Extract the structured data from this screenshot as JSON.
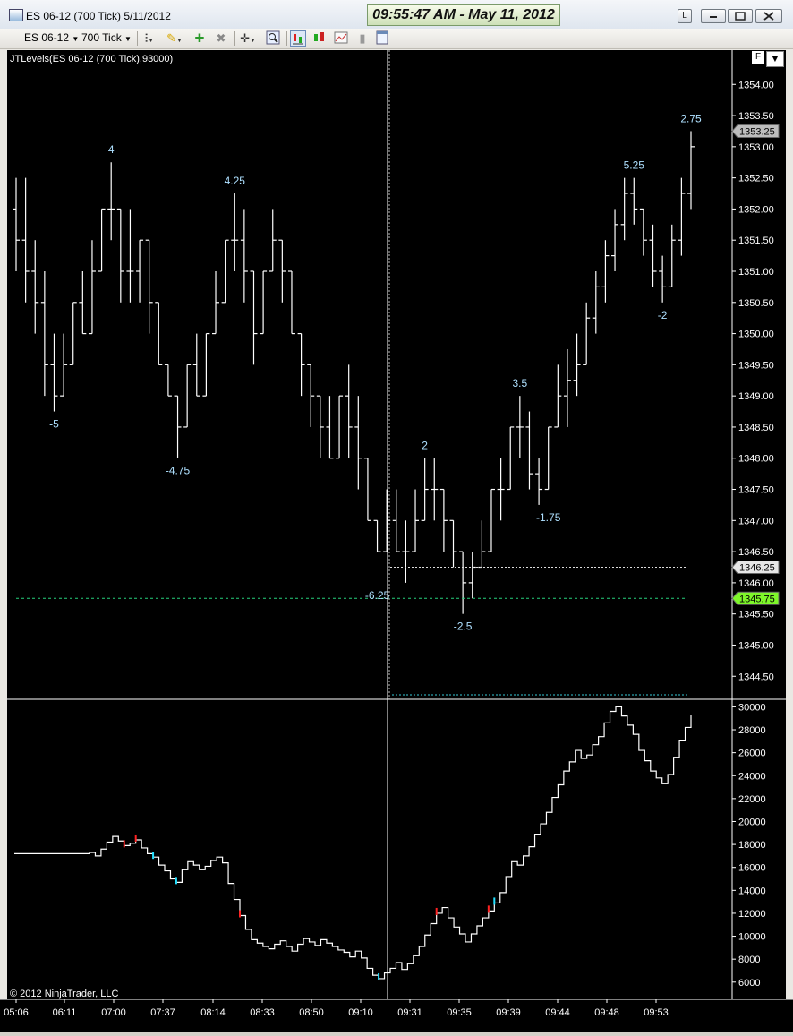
{
  "window": {
    "title": "ES 06-12 (700 Tick)  5/11/2012",
    "clock": "09:55:47 AM - May 11, 2012",
    "btn_l": "L"
  },
  "toolbar": {
    "instrument": "ES 06-12",
    "period": "700 Tick"
  },
  "indicator_label": "JTLevels(ES 06-12 (700 Tick),93000)",
  "f_button": "F",
  "copyright": "© 2012 NinjaTrader, LLC",
  "colors": {
    "background": "#000000",
    "bars": "#ffffff",
    "level_label": "#aee0ff",
    "green_line": "#26d07c",
    "cyan_line": "#36c9d6",
    "current_price": "#7ef72a",
    "marker_red": "#ff2222",
    "marker_cyan": "#22e0ff"
  },
  "chart_data": [
    {
      "type": "ohlc",
      "price_axis": {
        "ticks": [
          "1354.00",
          "1353.50",
          "1353.00",
          "1352.50",
          "1352.00",
          "1351.50",
          "1351.00",
          "1350.50",
          "1350.00",
          "1349.50",
          "1349.00",
          "1348.50",
          "1348.00",
          "1347.50",
          "1347.00",
          "1346.50",
          "1346.00",
          "1345.50",
          "1345.00",
          "1344.50"
        ],
        "range": [
          1344.13,
          1354.55
        ]
      },
      "price_labels": [
        {
          "text": "1353.25",
          "value": 1353.25,
          "style": "gray"
        },
        {
          "text": "1346.25",
          "value": 1346.25,
          "style": "light"
        },
        {
          "text": "1345.75",
          "value": 1345.75,
          "style": "green"
        }
      ],
      "levels": [
        {
          "text": "4",
          "value": 1352.75,
          "side": "high"
        },
        {
          "text": "-5",
          "value": 1348.75,
          "side": "low"
        },
        {
          "text": "4.25",
          "value": 1352.25,
          "side": "high"
        },
        {
          "text": "-4.75",
          "value": 1348.0,
          "side": "low"
        },
        {
          "text": "2",
          "value": 1348.0,
          "side": "high"
        },
        {
          "text": "-6.25",
          "value": 1346.0,
          "side": "low"
        },
        {
          "text": "-2.5",
          "value": 1345.5,
          "side": "low"
        },
        {
          "text": "3.5",
          "value": 1349.0,
          "side": "high"
        },
        {
          "text": "-1.75",
          "value": 1347.25,
          "side": "low"
        },
        {
          "text": "5.25",
          "value": 1352.5,
          "side": "high"
        },
        {
          "text": "-2",
          "value": 1350.5,
          "side": "low"
        },
        {
          "text": "2.75",
          "value": 1353.25,
          "side": "high"
        }
      ],
      "horizontal_lines": [
        {
          "value": 1346.25,
          "style": "dotted-white"
        },
        {
          "value": 1345.75,
          "style": "dashed-green"
        }
      ],
      "bars": [
        [
          1352.0,
          1352.5,
          1351.0,
          1351.5
        ],
        [
          1351.5,
          1352.5,
          1350.5,
          1351.0
        ],
        [
          1351.0,
          1351.5,
          1350.0,
          1350.5
        ],
        [
          1350.5,
          1351.0,
          1349.0,
          1349.5
        ],
        [
          1349.5,
          1350.0,
          1348.75,
          1349.0
        ],
        [
          1349.0,
          1350.0,
          1349.0,
          1349.5
        ],
        [
          1349.5,
          1350.5,
          1349.5,
          1350.5
        ],
        [
          1350.5,
          1351.0,
          1350.0,
          1350.0
        ],
        [
          1350.0,
          1351.5,
          1350.0,
          1351.0
        ],
        [
          1351.0,
          1352.0,
          1351.0,
          1352.0
        ],
        [
          1352.0,
          1352.75,
          1351.5,
          1352.0
        ],
        [
          1352.0,
          1352.0,
          1350.5,
          1351.0
        ],
        [
          1351.0,
          1352.0,
          1350.5,
          1351.0
        ],
        [
          1351.0,
          1351.5,
          1350.5,
          1351.5
        ],
        [
          1351.5,
          1351.5,
          1350.0,
          1350.5
        ],
        [
          1350.5,
          1350.5,
          1349.5,
          1349.5
        ],
        [
          1349.5,
          1349.5,
          1349.0,
          1349.0
        ],
        [
          1349.0,
          1349.0,
          1348.0,
          1348.5
        ],
        [
          1348.5,
          1349.5,
          1348.5,
          1349.5
        ],
        [
          1349.5,
          1350.0,
          1349.0,
          1349.0
        ],
        [
          1349.0,
          1350.0,
          1349.0,
          1350.0
        ],
        [
          1350.0,
          1351.0,
          1350.0,
          1350.5
        ],
        [
          1350.5,
          1351.5,
          1350.5,
          1351.5
        ],
        [
          1351.5,
          1352.25,
          1351.0,
          1351.5
        ],
        [
          1351.5,
          1352.0,
          1350.5,
          1351.0
        ],
        [
          1351.0,
          1351.0,
          1349.5,
          1350.0
        ],
        [
          1350.0,
          1351.0,
          1350.0,
          1351.0
        ],
        [
          1351.0,
          1352.0,
          1351.0,
          1351.5
        ],
        [
          1351.5,
          1351.5,
          1350.5,
          1351.0
        ],
        [
          1351.0,
          1351.0,
          1350.0,
          1350.0
        ],
        [
          1350.0,
          1350.0,
          1349.0,
          1349.5
        ],
        [
          1349.5,
          1349.5,
          1348.5,
          1349.0
        ],
        [
          1349.0,
          1349.0,
          1348.0,
          1348.5
        ],
        [
          1348.5,
          1349.0,
          1348.0,
          1348.0
        ],
        [
          1348.0,
          1349.0,
          1348.0,
          1349.0
        ],
        [
          1349.0,
          1349.5,
          1348.0,
          1348.5
        ],
        [
          1348.5,
          1349.0,
          1347.5,
          1348.0
        ],
        [
          1348.0,
          1348.0,
          1347.0,
          1347.0
        ],
        [
          1347.0,
          1347.0,
          1346.5,
          1346.5
        ],
        [
          1346.5,
          1347.5,
          1346.5,
          1347.0
        ],
        [
          1347.0,
          1347.5,
          1346.5,
          1346.5
        ],
        [
          1346.5,
          1347.0,
          1346.0,
          1346.5
        ],
        [
          1346.5,
          1347.5,
          1346.5,
          1347.0
        ],
        [
          1347.0,
          1348.0,
          1347.0,
          1347.5
        ],
        [
          1347.5,
          1348.0,
          1347.0,
          1347.5
        ],
        [
          1347.5,
          1347.5,
          1346.5,
          1347.0
        ],
        [
          1347.0,
          1347.0,
          1346.25,
          1346.5
        ],
        [
          1346.5,
          1346.5,
          1345.5,
          1346.0
        ],
        [
          1346.0,
          1346.5,
          1345.75,
          1346.25
        ],
        [
          1346.25,
          1347.0,
          1346.25,
          1346.5
        ],
        [
          1346.5,
          1347.5,
          1346.5,
          1347.5
        ],
        [
          1347.5,
          1348.0,
          1347.0,
          1347.5
        ],
        [
          1347.5,
          1348.5,
          1347.5,
          1348.5
        ],
        [
          1348.5,
          1349.0,
          1348.0,
          1348.5
        ],
        [
          1348.5,
          1348.75,
          1347.5,
          1347.75
        ],
        [
          1347.75,
          1348.0,
          1347.25,
          1347.5
        ],
        [
          1347.5,
          1348.5,
          1347.5,
          1348.5
        ],
        [
          1348.5,
          1349.5,
          1348.5,
          1349.0
        ],
        [
          1349.0,
          1349.75,
          1348.5,
          1349.25
        ],
        [
          1349.25,
          1350.0,
          1349.0,
          1349.5
        ],
        [
          1349.5,
          1350.5,
          1349.5,
          1350.25
        ],
        [
          1350.25,
          1351.0,
          1350.0,
          1350.75
        ],
        [
          1350.75,
          1351.5,
          1350.5,
          1351.25
        ],
        [
          1351.25,
          1352.0,
          1351.0,
          1351.75
        ],
        [
          1351.75,
          1352.5,
          1351.5,
          1352.25
        ],
        [
          1352.25,
          1352.5,
          1351.75,
          1352.0
        ],
        [
          1352.0,
          1352.0,
          1351.25,
          1351.5
        ],
        [
          1351.5,
          1351.75,
          1350.75,
          1351.0
        ],
        [
          1351.0,
          1351.25,
          1350.5,
          1350.75
        ],
        [
          1350.75,
          1351.75,
          1350.75,
          1351.5
        ],
        [
          1351.5,
          1352.5,
          1351.25,
          1352.25
        ],
        [
          1352.25,
          1353.25,
          1352.0,
          1353.0
        ]
      ]
    },
    {
      "type": "line",
      "value_axis": {
        "ticks": [
          "30000",
          "28000",
          "26000",
          "24000",
          "22000",
          "20000",
          "18000",
          "16000",
          "14000",
          "12000",
          "10000",
          "8000",
          "6000"
        ],
        "range": [
          4500,
          30500
        ]
      },
      "values": [
        17200,
        17200,
        17200,
        17200,
        17200,
        17200,
        17200,
        17200,
        17200,
        17200,
        17200,
        17200,
        17200,
        17300,
        17000,
        17600,
        18200,
        18700,
        18300,
        17900,
        18100,
        18400,
        17700,
        17200,
        16900,
        16200,
        15700,
        15000,
        14700,
        15800,
        16500,
        16200,
        15800,
        16100,
        16600,
        16900,
        16400,
        14600,
        13200,
        11800,
        10600,
        9700,
        9400,
        9100,
        8900,
        9300,
        9600,
        9100,
        8700,
        9300,
        9800,
        9500,
        9200,
        9700,
        9400,
        9100,
        8800,
        8600,
        8200,
        8700,
        8100,
        7200,
        6600,
        6300,
        6800,
        7200,
        7700,
        7100,
        7600,
        8300,
        9100,
        10100,
        11100,
        12000,
        12500,
        11600,
        10800,
        10200,
        9500,
        10200,
        10900,
        11600,
        12200,
        12900,
        13800,
        15200,
        16500,
        16200,
        17000,
        17800,
        18900,
        19800,
        20800,
        22100,
        23200,
        24400,
        25200,
        26200,
        25500,
        25800,
        26700,
        27400,
        28600,
        29600,
        30000,
        29200,
        28400,
        27600,
        26200,
        25300,
        24400,
        23800,
        23300,
        24100,
        25600,
        27100,
        28200,
        29300
      ],
      "markers": [
        {
          "index": 19,
          "color": "red"
        },
        {
          "index": 21,
          "color": "red"
        },
        {
          "index": 24,
          "color": "cyan"
        },
        {
          "index": 28,
          "color": "cyan"
        },
        {
          "index": 39,
          "color": "red"
        },
        {
          "index": 63,
          "color": "cyan"
        },
        {
          "index": 73,
          "color": "red"
        },
        {
          "index": 82,
          "color": "red"
        },
        {
          "index": 83,
          "color": "cyan"
        }
      ]
    }
  ],
  "time_axis": {
    "labels": [
      "05:06",
      "06:11",
      "07:00",
      "07:37",
      "08:14",
      "08:33",
      "08:50",
      "09:10",
      "09:31",
      "09:35",
      "09:39",
      "09:44",
      "09:48",
      "09:53"
    ]
  }
}
